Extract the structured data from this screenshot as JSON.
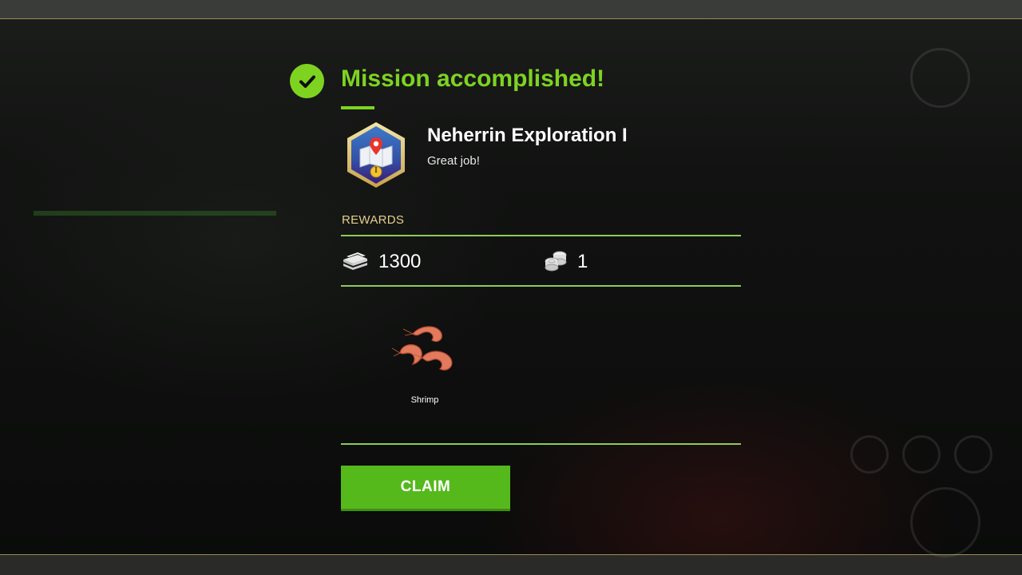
{
  "dialog": {
    "title": "Mission accomplished!",
    "mission_name": "Neherrin Exploration I",
    "mission_subtitle": "Great job!",
    "badge_icon": "map-pin-badge-icon",
    "badge_numeral": "I"
  },
  "rewards": {
    "label": "REWARDS",
    "cash": {
      "icon": "cash-stack-icon",
      "amount": "1300"
    },
    "coins": {
      "icon": "coin-stack-icon",
      "amount": "1"
    },
    "items": [
      {
        "name": "Shrimp",
        "icon": "shrimp-icon"
      }
    ]
  },
  "actions": {
    "claim_label": "CLAIM"
  },
  "colors": {
    "accent_green": "#7ed321",
    "button_green": "#55b91c",
    "rewards_gold": "#e6cf8a",
    "rule_green": "#8ecb5a"
  }
}
